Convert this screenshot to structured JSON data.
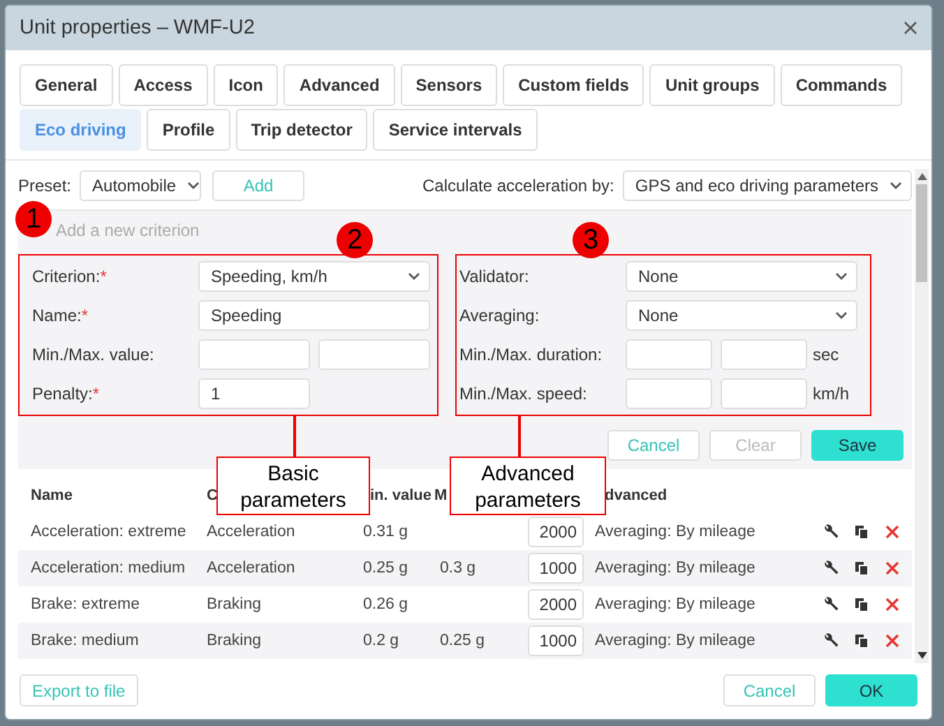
{
  "window": {
    "title": "Unit properties – WMF-U2"
  },
  "tabs": [
    {
      "label": "General",
      "selected": false
    },
    {
      "label": "Access",
      "selected": false
    },
    {
      "label": "Icon",
      "selected": false
    },
    {
      "label": "Advanced",
      "selected": false
    },
    {
      "label": "Sensors",
      "selected": false
    },
    {
      "label": "Custom fields",
      "selected": false
    },
    {
      "label": "Unit groups",
      "selected": false
    },
    {
      "label": "Commands",
      "selected": false
    },
    {
      "label": "Eco driving",
      "selected": true
    },
    {
      "label": "Profile",
      "selected": false
    },
    {
      "label": "Trip detector",
      "selected": false
    },
    {
      "label": "Service intervals",
      "selected": false
    }
  ],
  "preset": {
    "label": "Preset:",
    "value": "Automobile",
    "add_button": "Add"
  },
  "acceleration": {
    "label": "Calculate acceleration by:",
    "value": "GPS and eco driving parameters"
  },
  "new_criterion": {
    "placeholder": "Add a new criterion"
  },
  "required_mark": "*",
  "basic_fields": [
    {
      "kind": "select",
      "label": "Criterion:",
      "required": true,
      "value": "Speeding, km/h"
    },
    {
      "kind": "text",
      "label": "Name:",
      "required": true,
      "value": "Speeding"
    },
    {
      "kind": "range",
      "label": "Min./Max. value:",
      "required": false
    },
    {
      "kind": "short",
      "label": "Penalty:",
      "required": true,
      "value": "1"
    }
  ],
  "advanced_fields": [
    {
      "kind": "select",
      "label": "Validator:",
      "required": false,
      "value": "None"
    },
    {
      "kind": "select",
      "label": "Averaging:",
      "required": false,
      "value": "None"
    },
    {
      "kind": "range",
      "label": "Min./Max. duration:",
      "required": false,
      "unit": "sec"
    },
    {
      "kind": "range",
      "label": "Min./Max. speed:",
      "required": false,
      "unit": "km/h"
    }
  ],
  "form_buttons": [
    {
      "label": "Cancel",
      "kind": "secondary",
      "disabled": false
    },
    {
      "label": "Clear",
      "kind": "secondary",
      "disabled": true
    },
    {
      "label": "Save",
      "kind": "primary",
      "disabled": false
    }
  ],
  "table": {
    "columns": [
      "Name",
      "C",
      "in. value",
      "M",
      "dvanced"
    ],
    "rows": [
      {
        "name": "Acceleration: extreme",
        "criterion": "Acceleration",
        "min": "0.31 g",
        "penalty": "2000",
        "advanced": "Averaging: By mileage"
      },
      {
        "name": "Acceleration: medium",
        "criterion": "Acceleration",
        "min": "0.25 g",
        "max": "0.3 g",
        "penalty": "1000",
        "advanced": "Averaging: By mileage"
      },
      {
        "name": "Brake: extreme",
        "criterion": "Braking",
        "min": "0.26 g",
        "penalty": "2000",
        "advanced": "Averaging: By mileage"
      },
      {
        "name": "Brake: medium",
        "criterion": "Braking",
        "min": "0.2 g",
        "max": "0.25 g",
        "penalty": "1000",
        "advanced": "Averaging: By mileage"
      }
    ]
  },
  "footer": {
    "export_button": "Export to file",
    "buttons": [
      {
        "label": "Cancel",
        "kind": "secondary"
      },
      {
        "label": "OK",
        "kind": "primary"
      }
    ]
  },
  "annotations": {
    "markers": [
      "1",
      "2",
      "3"
    ],
    "callouts": [
      "Basic parameters",
      "Advanced parameters"
    ]
  }
}
